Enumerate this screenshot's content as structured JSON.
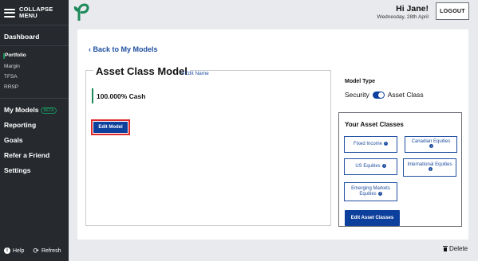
{
  "sidebar": {
    "collapse_label_1": "COLLAPSE",
    "collapse_label_2": "MENU",
    "items": {
      "dashboard": "Dashboard",
      "portfolio": "Portfolio",
      "margin": "Margin",
      "tfsa": "TFSA",
      "rrsp": "RRSP",
      "my_models": "My Models",
      "my_models_badge": "BETA",
      "reporting": "Reporting",
      "goals": "Goals",
      "refer": "Refer a Friend",
      "settings": "Settings"
    },
    "help": "Help",
    "refresh": "Refresh"
  },
  "header": {
    "greeting": "Hi Jane!",
    "date": "Wednesday, 28th April",
    "logout": "LOGOUT"
  },
  "main": {
    "back_link": "Back to My Models",
    "model_title": "Asset Class Model",
    "edit_name": "Edit Name",
    "allocation": "100.000% Cash",
    "edit_model": "Edit Model",
    "model_type_label": "Model Type",
    "toggle_left": "Security",
    "toggle_right": "Asset Class",
    "toggle_state": "Asset Class",
    "your_classes_title": "Your Asset Classes",
    "asset_classes": [
      "Fixed Income",
      "Canadian Equities",
      "US Equities",
      "International Equities",
      "Emerging Markets Equities"
    ],
    "edit_classes": "Edit Asset Classes",
    "delete": "Delete"
  },
  "colors": {
    "sidebar_bg": "#26292e",
    "primary_blue": "#0d3f9c",
    "link_blue": "#1f4fa0",
    "accent_green": "#1b8a5a",
    "highlight_red": "#e0292b"
  }
}
